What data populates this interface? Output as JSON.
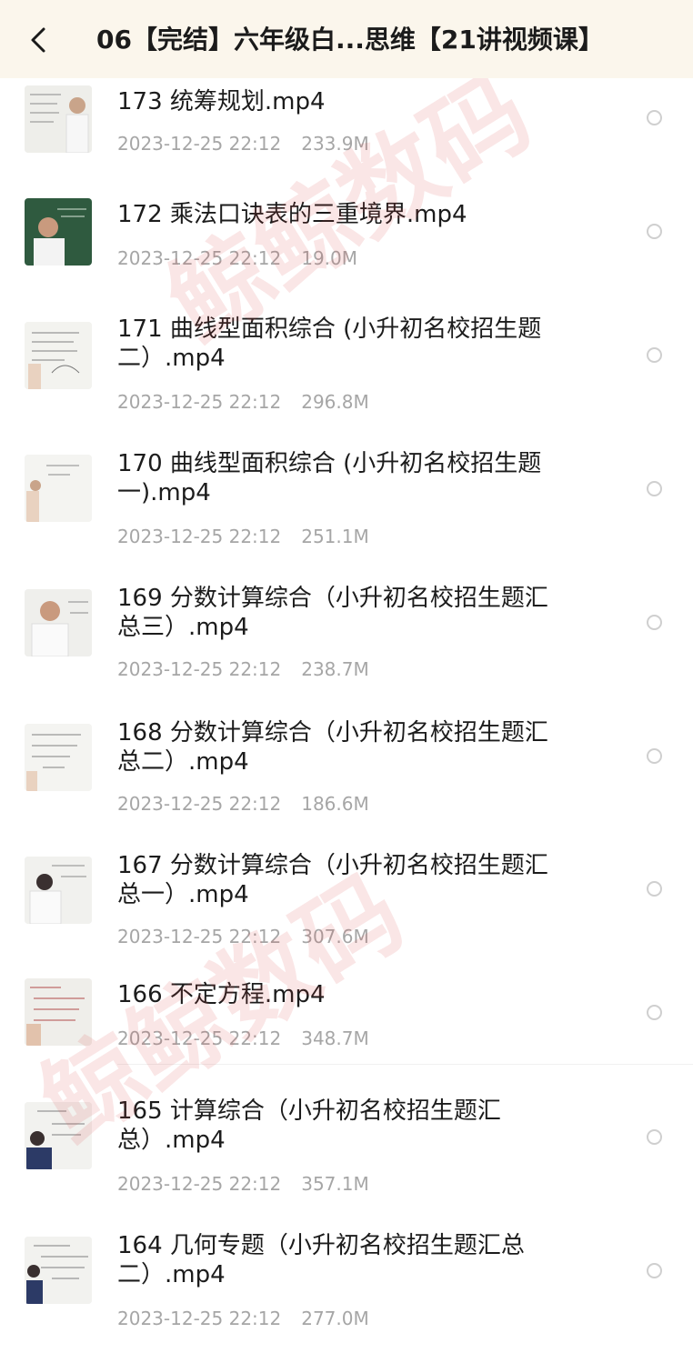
{
  "header": {
    "title": "06【完结】六年级白...思维【21讲视频课】",
    "back_icon": "chevron-left-icon"
  },
  "files": [
    {
      "name": "173 统筹规划.mp4",
      "date": "2023-12-25 22:12",
      "size": "233.9M",
      "thumb": "teacher-whiteboard"
    },
    {
      "name": "172 乘法口诀表的三重境界.mp4",
      "date": "2023-12-25 22:12",
      "size": "19.0M",
      "thumb": "teacher-chalkboard"
    },
    {
      "name": "171 曲线型面积综合 (小升初名校招生题二）.mp4",
      "date": "2023-12-25 22:12",
      "size": "296.8M",
      "thumb": "whiteboard-notes"
    },
    {
      "name": "170 曲线型面积综合 (小升初名校招生题一).mp4",
      "date": "2023-12-25 22:12",
      "size": "251.1M",
      "thumb": "whiteboard-notes"
    },
    {
      "name": "169 分数计算综合（小升初名校招生题汇总三）.mp4",
      "date": "2023-12-25 22:12",
      "size": "238.7M",
      "thumb": "teacher-whiteboard"
    },
    {
      "name": "168 分数计算综合（小升初名校招生题汇总二）.mp4",
      "date": "2023-12-25 22:12",
      "size": "186.6M",
      "thumb": "whiteboard-notes"
    },
    {
      "name": "167 分数计算综合（小升初名校招生题汇总一）.mp4",
      "date": "2023-12-25 22:12",
      "size": "307.6M",
      "thumb": "teacher-writing"
    },
    {
      "name": "166 不定方程.mp4",
      "date": "2023-12-25 22:12",
      "size": "348.7M",
      "thumb": "whiteboard-notes"
    },
    {
      "name": "165 计算综合（小升初名校招生题汇总）.mp4",
      "date": "2023-12-25 22:12",
      "size": "357.1M",
      "thumb": "teacher-writing"
    },
    {
      "name": "164 几何专题（小升初名校招生题汇总二）.mp4",
      "date": "2023-12-25 22:12",
      "size": "277.0M",
      "thumb": "teacher-writing"
    }
  ],
  "watermark": {
    "text": "鲸鲸数码",
    "color": "#dc3c3c"
  }
}
